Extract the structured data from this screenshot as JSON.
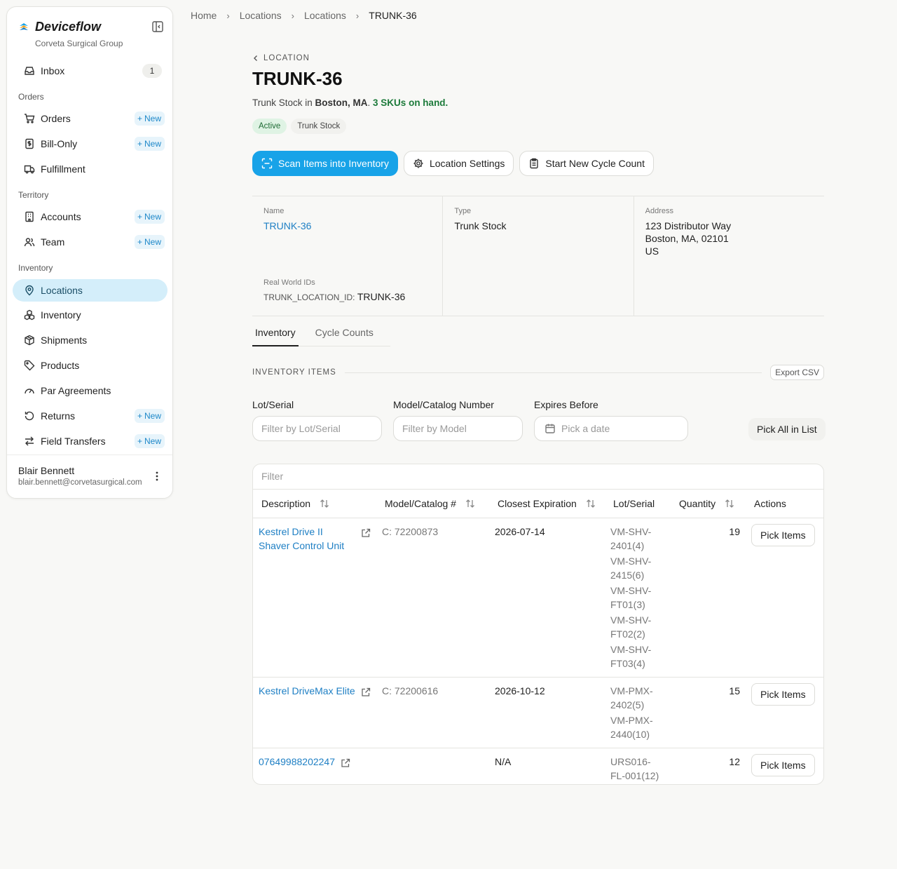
{
  "app": {
    "brand": "Deviceflow",
    "org": "Corveta Surgical Group"
  },
  "sidebar": {
    "inbox": {
      "label": "Inbox",
      "count": "1"
    },
    "sections": {
      "orders": "Orders",
      "territory": "Territory",
      "inventory": "Inventory"
    },
    "new_label": "New",
    "items": {
      "orders": "Orders",
      "bill_only": "Bill-Only",
      "fulfillment": "Fulfillment",
      "accounts": "Accounts",
      "team": "Team",
      "locations": "Locations",
      "inventory": "Inventory",
      "shipments": "Shipments",
      "products": "Products",
      "par_agreements": "Par Agreements",
      "returns": "Returns",
      "field_transfers": "Field Transfers"
    },
    "user": {
      "name": "Blair Bennett",
      "email": "blair.bennett@corvetasurgical.com"
    }
  },
  "breadcrumb": [
    "Home",
    "Locations",
    "Locations",
    "TRUNK-36"
  ],
  "header": {
    "back_label": "LOCATION",
    "title": "TRUNK-36",
    "subtitle_prefix": "Trunk Stock in ",
    "subtitle_city": "Boston, MA",
    "subtitle_period": ". ",
    "subtitle_sku": "3 SKUs on hand.",
    "tags": {
      "status": "Active",
      "type": "Trunk Stock"
    }
  },
  "actions": {
    "scan": "Scan Items into Inventory",
    "settings": "Location Settings",
    "cycle": "Start New Cycle Count"
  },
  "info": {
    "name_label": "Name",
    "name_value": "TRUNK-36",
    "rwid_label": "Real World IDs",
    "rwid_key": "TRUNK_LOCATION_ID: ",
    "rwid_value": "TRUNK-36",
    "type_label": "Type",
    "type_value": "Trunk Stock",
    "address_label": "Address",
    "address_line1": "123 Distributor Way",
    "address_line2": "Boston, MA, 02101",
    "address_line3": "US"
  },
  "tabs": {
    "inventory": "Inventory",
    "cycle_counts": "Cycle Counts"
  },
  "inventory_section": {
    "title": "INVENTORY ITEMS",
    "export": "Export CSV",
    "filters": {
      "lot_label": "Lot/Serial",
      "lot_placeholder": "Filter by Lot/Serial",
      "model_label": "Model/Catalog Number",
      "model_placeholder": "Filter by Model",
      "expires_label": "Expires Before",
      "expires_placeholder": "Pick a date",
      "pick_all": "Pick All in List"
    },
    "table": {
      "filter_placeholder": "Filter",
      "columns": {
        "description": "Description",
        "model": "Model/Catalog #",
        "expiration": "Closest Expiration",
        "lot": "Lot/Serial",
        "quantity": "Quantity",
        "actions": "Actions"
      },
      "pick_label": "Pick Items",
      "rows": [
        {
          "description": "Kestrel Drive II Shaver Control Unit",
          "model": "C: 72200873",
          "expiration": "2026-07-14",
          "lots": [
            "VM-SHV-2401(4)",
            "VM-SHV-2415(6)",
            "VM-SHV-FT01(3)",
            "VM-SHV-FT02(2)",
            "VM-SHV-FT03(4)"
          ],
          "quantity": "19"
        },
        {
          "description": "Kestrel DriveMax Elite",
          "model": "C: 72200616",
          "expiration": "2026-10-12",
          "lots": [
            "VM-PMX-2402(5)",
            "VM-PMX-2440(10)"
          ],
          "quantity": "15"
        },
        {
          "description": "07649988202247",
          "model": "",
          "expiration": "N/A",
          "lots": [
            "URS016-FL-001(12)"
          ],
          "quantity": "12"
        }
      ]
    }
  },
  "colors": {
    "primary": "#18a3e8",
    "link": "#1e7fc4",
    "active_nav": "#d4eefa",
    "success": "#1c7a3a"
  }
}
